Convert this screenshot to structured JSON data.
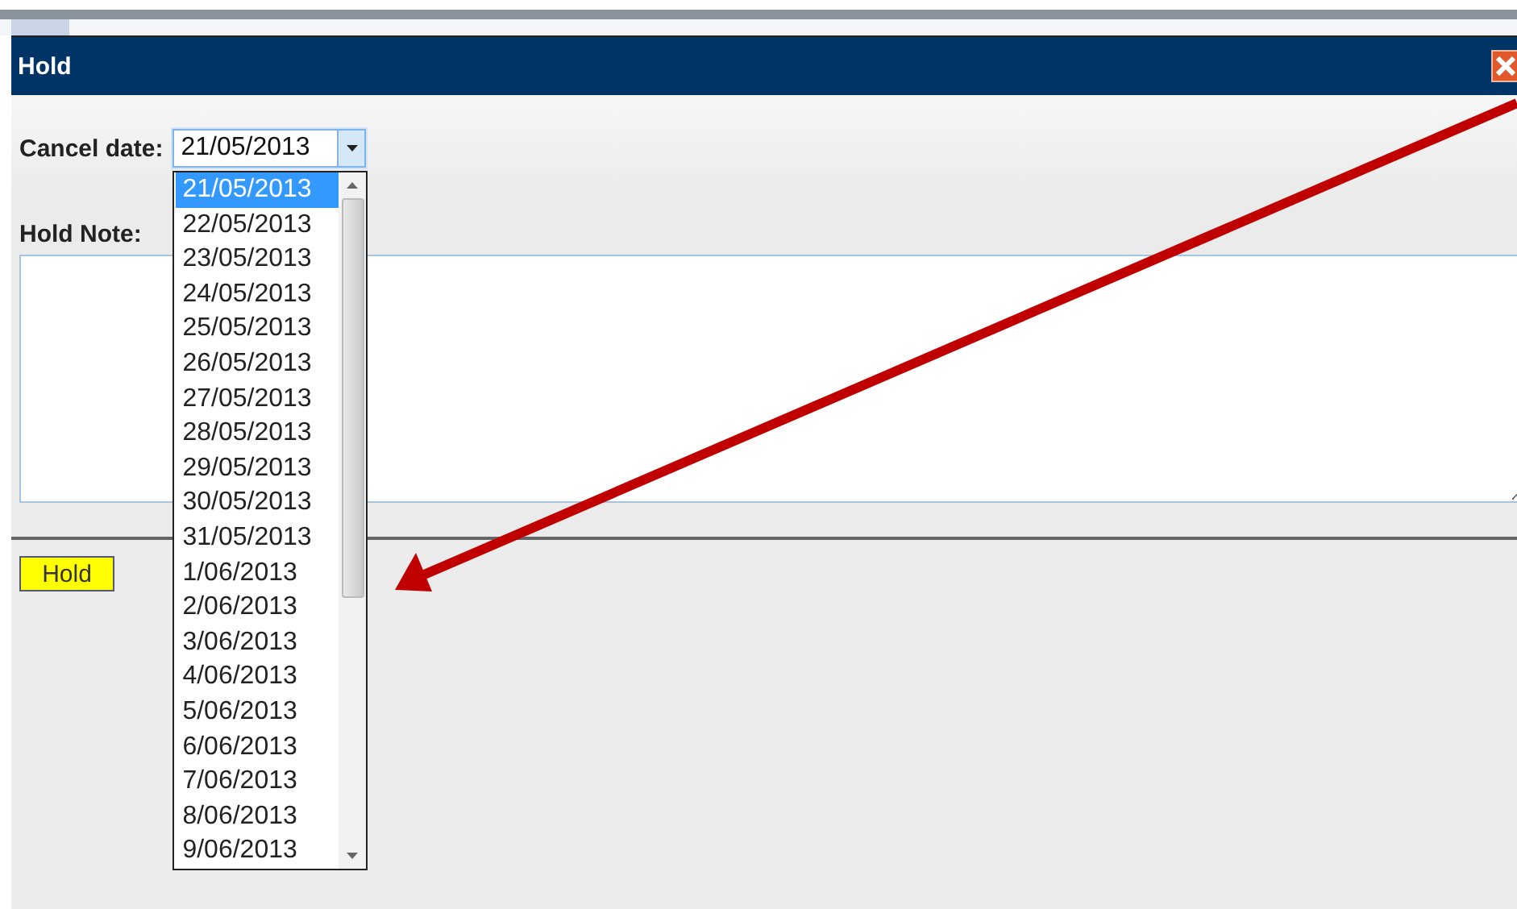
{
  "window": {
    "title": "Hold"
  },
  "cancel_date": {
    "label": "Cancel date:",
    "value": "21/05/2013",
    "expanded": true,
    "options": [
      {
        "label": "21/05/2013",
        "selected": true
      },
      {
        "label": "22/05/2013",
        "selected": false
      },
      {
        "label": "23/05/2013",
        "selected": false
      },
      {
        "label": "24/05/2013",
        "selected": false
      },
      {
        "label": "25/05/2013",
        "selected": false
      },
      {
        "label": "26/05/2013",
        "selected": false
      },
      {
        "label": "27/05/2013",
        "selected": false
      },
      {
        "label": "28/05/2013",
        "selected": false
      },
      {
        "label": "29/05/2013",
        "selected": false
      },
      {
        "label": "30/05/2013",
        "selected": false
      },
      {
        "label": "31/05/2013",
        "selected": false
      },
      {
        "label": "1/06/2013",
        "selected": false
      },
      {
        "label": "2/06/2013",
        "selected": false
      },
      {
        "label": "3/06/2013",
        "selected": false
      },
      {
        "label": "4/06/2013",
        "selected": false
      },
      {
        "label": "5/06/2013",
        "selected": false
      },
      {
        "label": "6/06/2013",
        "selected": false
      },
      {
        "label": "7/06/2013",
        "selected": false
      },
      {
        "label": "8/06/2013",
        "selected": false
      },
      {
        "label": "9/06/2013",
        "selected": false
      }
    ]
  },
  "hold_note": {
    "label": "Hold Note:"
  },
  "buttons": [
    {
      "label": "Hold"
    }
  ]
}
